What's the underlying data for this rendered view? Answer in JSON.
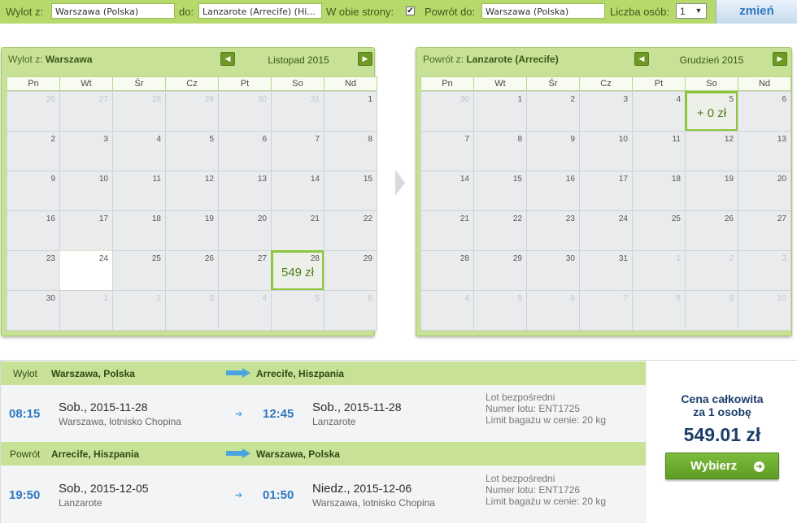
{
  "search": {
    "from_label": "Wylot z:",
    "from_value": "Warszawa (Polska)",
    "to_label": "do:",
    "to_value": "Lanzarote (Arrecife) (Hi...",
    "roundtrip_label": "W obie strony:",
    "roundtrip_checked": "✔",
    "return_label": "Powrót do:",
    "return_value": "Warszawa (Polska)",
    "persons_label": "Liczba osób:",
    "persons_value": "1",
    "submit_label": "zmień"
  },
  "calendars": {
    "outbound": {
      "route_prefix": "Wylot z:",
      "route_city": "Warszawa",
      "month": "Listopad 2015",
      "weekdays": [
        "Pn",
        "Wt",
        "Śr",
        "Cz",
        "Pt",
        "So",
        "Nd"
      ],
      "days": [
        [
          "26",
          "27",
          "28",
          "29",
          "30",
          "31",
          "1"
        ],
        [
          "2",
          "3",
          "4",
          "5",
          "6",
          "7",
          "8"
        ],
        [
          "9",
          "10",
          "11",
          "12",
          "13",
          "14",
          "15"
        ],
        [
          "16",
          "17",
          "18",
          "19",
          "20",
          "21",
          "22"
        ],
        [
          "23",
          "24",
          "25",
          "26",
          "27",
          "28",
          "29"
        ],
        [
          "30",
          "1",
          "2",
          "3",
          "4",
          "5",
          "6"
        ]
      ],
      "other_month": [
        [
          0,
          0
        ],
        [
          0,
          1
        ],
        [
          0,
          2
        ],
        [
          0,
          3
        ],
        [
          0,
          4
        ],
        [
          0,
          5
        ],
        [
          5,
          1
        ],
        [
          5,
          2
        ],
        [
          5,
          3
        ],
        [
          5,
          4
        ],
        [
          5,
          5
        ],
        [
          5,
          6
        ]
      ],
      "today": [
        4,
        1
      ],
      "selected": {
        "row": 4,
        "col": 5,
        "price": "549 zł"
      }
    },
    "return": {
      "route_prefix": "Powrót z:",
      "route_city": "Lanzarote (Arrecife)",
      "month": "Grudzień 2015",
      "weekdays": [
        "Pn",
        "Wt",
        "Śr",
        "Cz",
        "Pt",
        "So",
        "Nd"
      ],
      "days": [
        [
          "30",
          "1",
          "2",
          "3",
          "4",
          "5",
          "6"
        ],
        [
          "7",
          "8",
          "9",
          "10",
          "11",
          "12",
          "13"
        ],
        [
          "14",
          "15",
          "16",
          "17",
          "18",
          "19",
          "20"
        ],
        [
          "21",
          "22",
          "23",
          "24",
          "25",
          "26",
          "27"
        ],
        [
          "28",
          "29",
          "30",
          "31",
          "1",
          "2",
          "3"
        ],
        [
          "4",
          "5",
          "6",
          "7",
          "8",
          "9",
          "10"
        ]
      ],
      "other_month": [
        [
          0,
          0
        ],
        [
          4,
          4
        ],
        [
          4,
          5
        ],
        [
          4,
          6
        ],
        [
          5,
          0
        ],
        [
          5,
          1
        ],
        [
          5,
          2
        ],
        [
          5,
          3
        ],
        [
          5,
          4
        ],
        [
          5,
          5
        ],
        [
          5,
          6
        ]
      ],
      "selected": {
        "row": 0,
        "col": 5,
        "price": "+ 0 zł"
      }
    }
  },
  "summary": {
    "outbound": {
      "band_label": "Wylot",
      "from": "Warszawa, Polska",
      "to": "Arrecife, Hiszpania",
      "dep_time": "08:15",
      "dep_day": "Sob.,",
      "dep_date": " 2015-11-28",
      "dep_place": "Warszawa, lotnisko Chopina",
      "arr_time": "12:45",
      "arr_day": "Sob.,",
      "arr_date": " 2015-11-28",
      "arr_place": "Lanzarote",
      "info_type": "Lot bezpośredni",
      "info_flight": "Numer lotu: ENT1725",
      "info_bag": "Limit bagażu w cenie: 20 kg"
    },
    "return": {
      "band_label": "Powrót",
      "from": "Arrecife, Hiszpania",
      "to": "Warszawa, Polska",
      "dep_time": "19:50",
      "dep_day": "Sob.,",
      "dep_date": " 2015-12-05",
      "dep_place": "Lanzarote",
      "arr_time": "01:50",
      "arr_day": "Niedz.,",
      "arr_date": " 2015-12-06",
      "arr_place": "Warszawa, lotnisko Chopina",
      "info_type": "Lot bezpośredni",
      "info_flight": "Numer lotu: ENT1726",
      "info_bag": "Limit bagażu w cenie: 20 kg"
    },
    "price_title_1": "Cena całkowita",
    "price_title_2": "za 1 osobę",
    "price_value": "549.01 zł",
    "select_label": "Wybierz"
  },
  "icons": {
    "prev": "chevron-left-icon",
    "next": "chevron-right-icon",
    "plane_arrow": "arrow-right-icon",
    "small_arrow": "arrow-right-icon",
    "button_icon": "chevron-circle-right-icon",
    "select_arrow": "chevron-down-icon"
  },
  "colors": {
    "accent_green": "#8cc63f",
    "band_green": "#c7e296",
    "time_blue": "#2f78c0",
    "price_navy": "#1d3e6a"
  }
}
